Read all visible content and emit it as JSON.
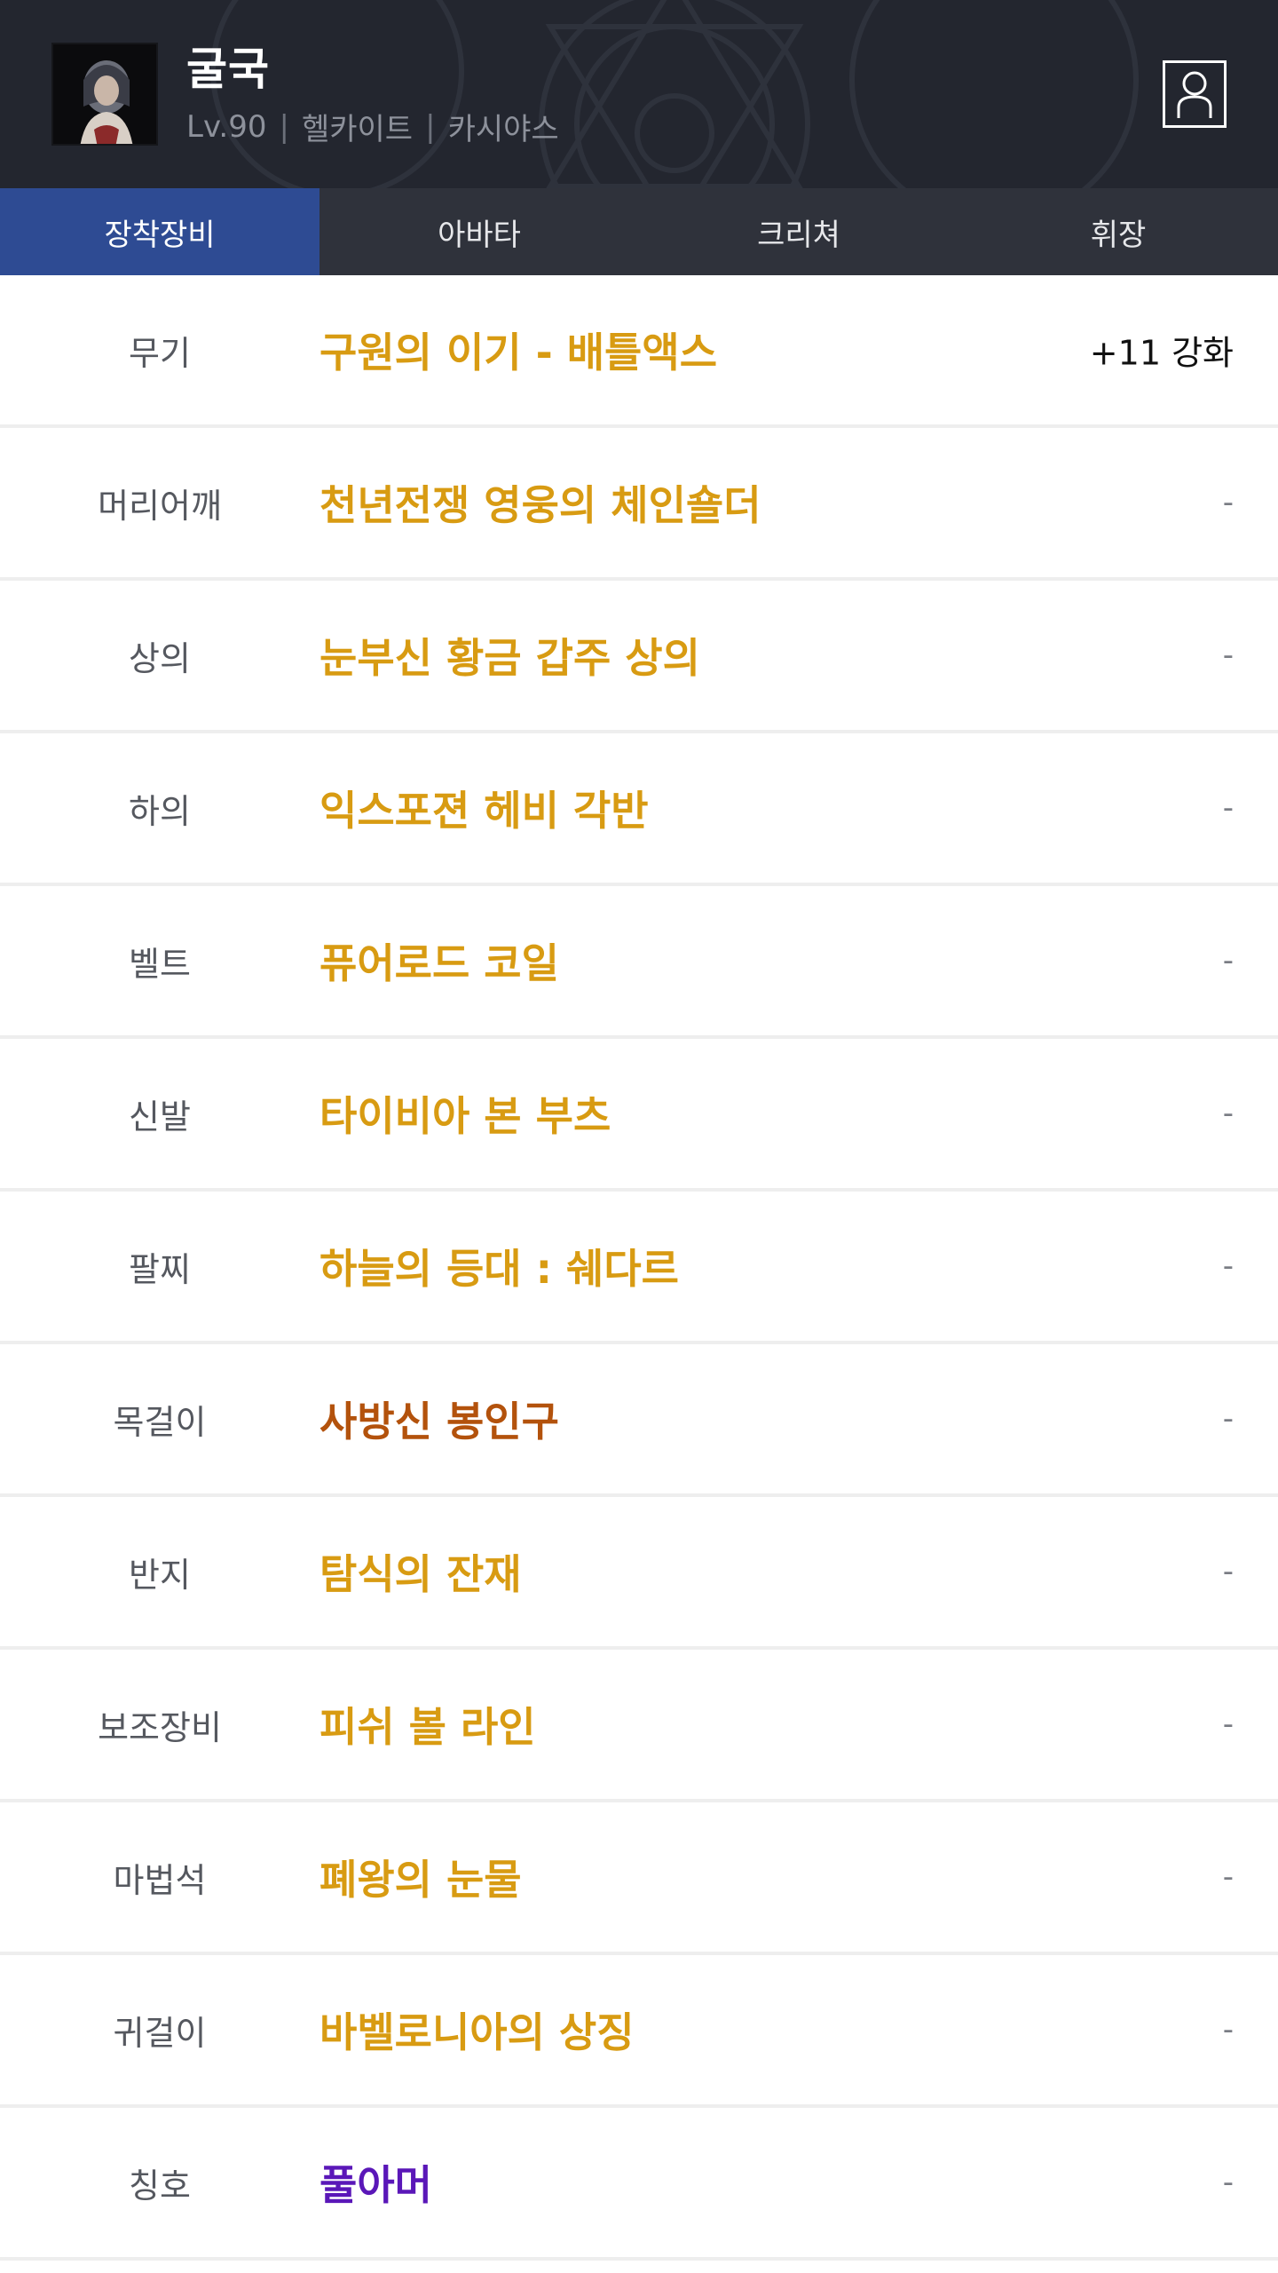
{
  "header": {
    "name": "굴국",
    "level": "Lv.90",
    "job": "헬카이트",
    "server": "카시야스",
    "separator": "|"
  },
  "tabs": [
    {
      "label": "장착장비",
      "active": true
    },
    {
      "label": "아바타",
      "active": false
    },
    {
      "label": "크리쳐",
      "active": false
    },
    {
      "label": "휘장",
      "active": false
    }
  ],
  "equipment": [
    {
      "slot": "무기",
      "item": "구원의 이기 - 배틀액스",
      "extra": "+11 강화",
      "rarity": "legendary"
    },
    {
      "slot": "머리어깨",
      "item": "천년전쟁 영웅의 체인숄더",
      "extra": "-",
      "rarity": "legendary"
    },
    {
      "slot": "상의",
      "item": "눈부신 황금 갑주 상의",
      "extra": "-",
      "rarity": "legendary"
    },
    {
      "slot": "하의",
      "item": "익스포젼 헤비 각반",
      "extra": "-",
      "rarity": "legendary"
    },
    {
      "slot": "벨트",
      "item": "퓨어로드 코일",
      "extra": "-",
      "rarity": "legendary"
    },
    {
      "slot": "신발",
      "item": "타이비아 본 부츠",
      "extra": "-",
      "rarity": "legendary"
    },
    {
      "slot": "팔찌",
      "item": "하늘의 등대 : 쉐다르",
      "extra": "-",
      "rarity": "legendary"
    },
    {
      "slot": "목걸이",
      "item": "사방신 봉인구",
      "extra": "-",
      "rarity": "epic"
    },
    {
      "slot": "반지",
      "item": "탐식의 잔재",
      "extra": "-",
      "rarity": "legendary"
    },
    {
      "slot": "보조장비",
      "item": "피쉬 볼 라인",
      "extra": "-",
      "rarity": "legendary"
    },
    {
      "slot": "마법석",
      "item": "폐왕의 눈물",
      "extra": "-",
      "rarity": "legendary"
    },
    {
      "slot": "귀걸이",
      "item": "바벨로니아의 상징",
      "extra": "-",
      "rarity": "legendary"
    },
    {
      "slot": "칭호",
      "item": "풀아머",
      "extra": "-",
      "rarity": "rare"
    }
  ],
  "colors": {
    "legendary": "#d89b12",
    "epic": "#b3520c",
    "rare": "#5a17b8",
    "active_tab": "#2e4b93",
    "header_bg": "#23262f"
  },
  "icons": {
    "profile": "user-profile-icon",
    "avatar": "character-portrait"
  }
}
